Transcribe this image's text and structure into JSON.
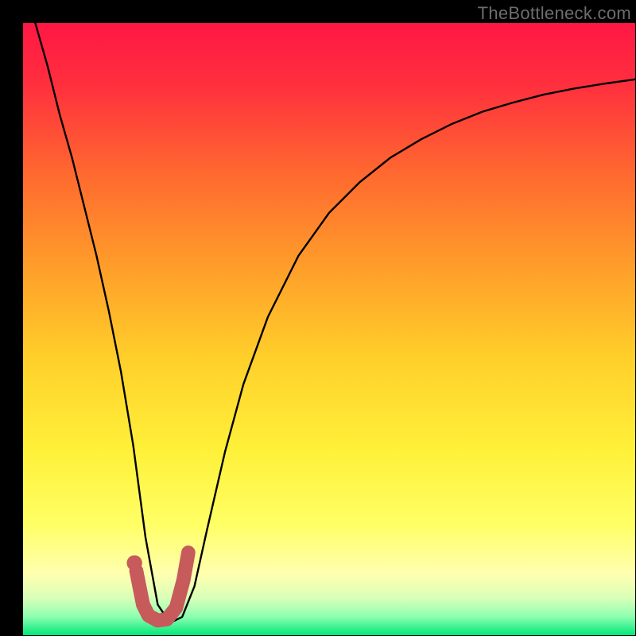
{
  "watermark": "TheBottleneck.com",
  "colors": {
    "black": "#000000",
    "curve": "#000000",
    "marker": "#c75a5a"
  },
  "chart_data": {
    "type": "line",
    "title": "",
    "xlabel": "",
    "ylabel": "",
    "xlim": [
      0,
      100
    ],
    "ylim": [
      0,
      100
    ],
    "grid": false,
    "legend_position": "none",
    "annotations": [
      "TheBottleneck.com"
    ],
    "gradient_stops": [
      {
        "pos": 0.0,
        "color": "#ff1744"
      },
      {
        "pos": 0.1,
        "color": "#ff2f3e"
      },
      {
        "pos": 0.25,
        "color": "#ff6a2f"
      },
      {
        "pos": 0.4,
        "color": "#ff9e2a"
      },
      {
        "pos": 0.55,
        "color": "#ffd02a"
      },
      {
        "pos": 0.7,
        "color": "#fff13a"
      },
      {
        "pos": 0.82,
        "color": "#ffff66"
      },
      {
        "pos": 0.9,
        "color": "#ffffb0"
      },
      {
        "pos": 0.94,
        "color": "#d8ffb8"
      },
      {
        "pos": 0.97,
        "color": "#8cffb0"
      },
      {
        "pos": 1.0,
        "color": "#00e878"
      }
    ],
    "series": [
      {
        "name": "bottleneck-curve",
        "x": [
          2,
          4,
          6,
          8,
          10,
          12,
          14,
          16,
          18,
          20,
          22,
          24,
          26,
          28,
          30,
          33,
          36,
          40,
          45,
          50,
          55,
          60,
          65,
          70,
          75,
          80,
          85,
          90,
          95,
          100
        ],
        "y": [
          100,
          93,
          85,
          78,
          70,
          62,
          53,
          43,
          31,
          16,
          5,
          2,
          3,
          8,
          17,
          30,
          41,
          52,
          62,
          69,
          74,
          78,
          81,
          83.5,
          85.5,
          87,
          88.3,
          89.3,
          90.1,
          90.8
        ]
      }
    ],
    "marker": {
      "name": "j-marker",
      "points_xy": [
        [
          18.5,
          10.5
        ],
        [
          19.6,
          5.0
        ],
        [
          20.5,
          3.2
        ],
        [
          22.0,
          2.4
        ],
        [
          23.5,
          2.6
        ],
        [
          25.0,
          4.5
        ],
        [
          26.2,
          9.0
        ],
        [
          27.0,
          13.5
        ]
      ],
      "dot_xy": [
        18.2,
        11.8
      ],
      "stroke_width_pct": 2.3
    }
  }
}
